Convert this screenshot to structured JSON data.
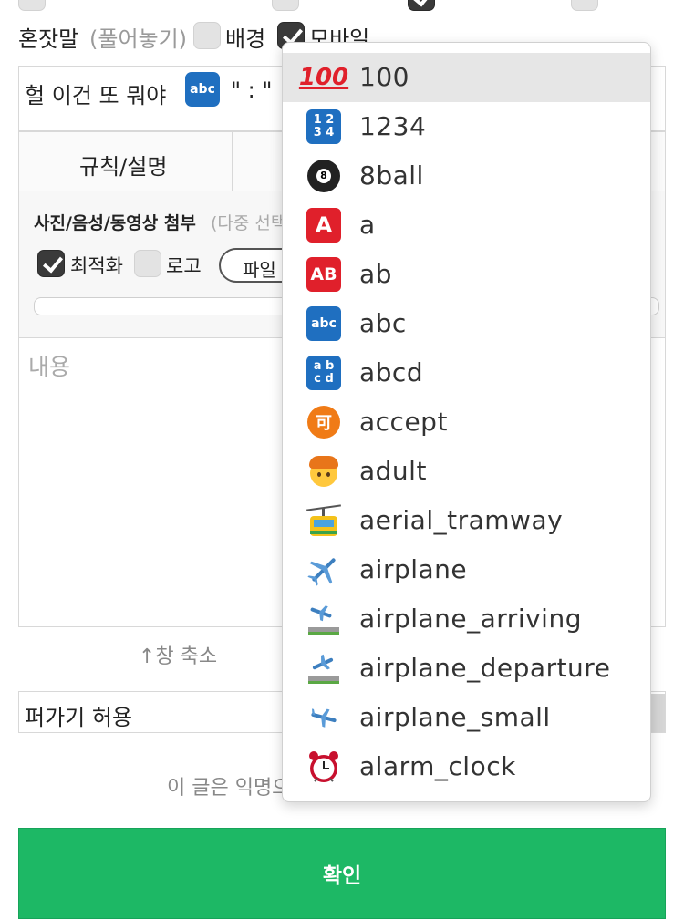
{
  "top_options": {
    "monologue_label": "혼잣말",
    "monologue_hint": "(풀어놓기)",
    "background_label": "배경",
    "mobile_label": "모바일",
    "mobile_checked": true
  },
  "title_input": {
    "text_before": "헐 이건 또 뭐야",
    "text_after": "\" : \""
  },
  "tabs": {
    "rules_label": "규칙/설명"
  },
  "attach": {
    "title": "사진/음성/동영상 첨부",
    "hint": "(다중 선택",
    "optimize_label": "최적화",
    "optimize_checked": true,
    "logo_label": "로고",
    "logo_checked": false,
    "file_button_label": "파일"
  },
  "content": {
    "placeholder": "내용"
  },
  "resize_label": "↑창 축소",
  "share_label": "퍼가기 허용",
  "anon_notice": "이 글은 익명으",
  "confirm_label": "확인",
  "colors": {
    "confirm_green": "#1db865",
    "selected_row": "#e6e6e6"
  },
  "emoji_dropdown": {
    "selected_index": 0,
    "items": [
      {
        "name": "100",
        "icon": "hundred-points-icon"
      },
      {
        "name": "1234",
        "icon": "input-numbers-icon"
      },
      {
        "name": "8ball",
        "icon": "pool-8-ball-icon"
      },
      {
        "name": "a",
        "icon": "a-button-icon"
      },
      {
        "name": "ab",
        "icon": "ab-button-icon"
      },
      {
        "name": "abc",
        "icon": "abc-icon"
      },
      {
        "name": "abcd",
        "icon": "abcd-icon"
      },
      {
        "name": "accept",
        "icon": "accept-icon"
      },
      {
        "name": "adult",
        "icon": "adult-face-icon"
      },
      {
        "name": "aerial_tramway",
        "icon": "aerial-tramway-icon"
      },
      {
        "name": "airplane",
        "icon": "airplane-icon"
      },
      {
        "name": "airplane_arriving",
        "icon": "airplane-arriving-icon"
      },
      {
        "name": "airplane_departure",
        "icon": "airplane-departure-icon"
      },
      {
        "name": "airplane_small",
        "icon": "small-airplane-icon"
      },
      {
        "name": "alarm_clock",
        "icon": "alarm-clock-icon"
      }
    ]
  }
}
